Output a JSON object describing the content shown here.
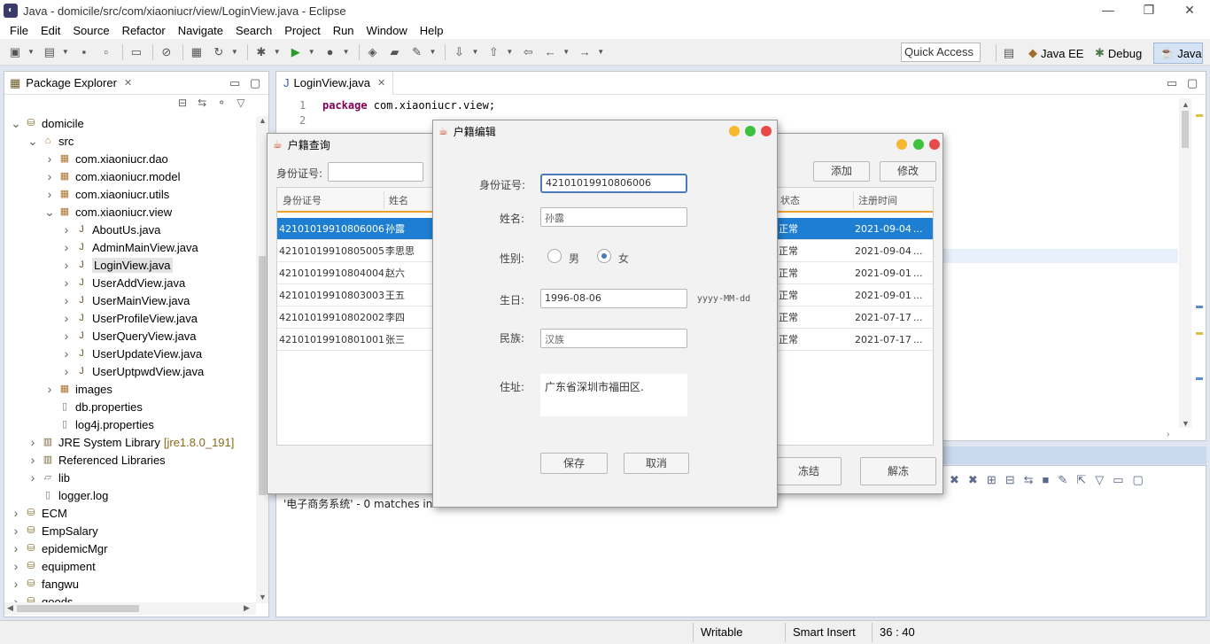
{
  "window": {
    "title": "Java - domicile/src/com/xiaoniucr/view/LoginView.java - Eclipse",
    "app_icon": "eclipse-icon"
  },
  "menu": [
    "File",
    "Edit",
    "Source",
    "Refactor",
    "Navigate",
    "Search",
    "Project",
    "Run",
    "Window",
    "Help"
  ],
  "quick_access": "Quick Access",
  "perspectives": [
    {
      "label": "Java EE",
      "icon": "java-ee-icon"
    },
    {
      "label": "Debug",
      "icon": "debug-icon"
    },
    {
      "label": "Java",
      "icon": "java-icon"
    }
  ],
  "package_explorer": {
    "title": "Package Explorer",
    "tree": [
      {
        "label": "domicile",
        "icon": "project-icon",
        "arrow": "v",
        "indent": 0
      },
      {
        "label": "src",
        "icon": "source-folder-icon",
        "arrow": "v",
        "indent": 1
      },
      {
        "label": "com.xiaoniucr.dao",
        "icon": "package-icon",
        "arrow": ">",
        "indent": 2
      },
      {
        "label": "com.xiaoniucr.model",
        "icon": "package-icon",
        "arrow": ">",
        "indent": 2
      },
      {
        "label": "com.xiaoniucr.utils",
        "icon": "package-icon",
        "arrow": ">",
        "indent": 2
      },
      {
        "label": "com.xiaoniucr.view",
        "icon": "package-icon",
        "arrow": "v",
        "indent": 2
      },
      {
        "label": "AboutUs.java",
        "icon": "java-file-icon",
        "arrow": ">",
        "indent": 3
      },
      {
        "label": "AdminMainView.java",
        "icon": "java-file-icon",
        "arrow": ">",
        "indent": 3
      },
      {
        "label": "LoginView.java",
        "icon": "java-file-icon",
        "arrow": ">",
        "indent": 3,
        "selected": true
      },
      {
        "label": "UserAddView.java",
        "icon": "java-file-icon",
        "arrow": ">",
        "indent": 3
      },
      {
        "label": "UserMainView.java",
        "icon": "java-file-icon",
        "arrow": ">",
        "indent": 3
      },
      {
        "label": "UserProfileView.java",
        "icon": "java-file-icon",
        "arrow": ">",
        "indent": 3
      },
      {
        "label": "UserQueryView.java",
        "icon": "java-file-icon",
        "arrow": ">",
        "indent": 3
      },
      {
        "label": "UserUpdateView.java",
        "icon": "java-file-icon",
        "arrow": ">",
        "indent": 3
      },
      {
        "label": "UserUptpwdView.java",
        "icon": "java-file-icon",
        "arrow": ">",
        "indent": 3
      },
      {
        "label": "images",
        "icon": "package-icon",
        "arrow": ">",
        "indent": 2
      },
      {
        "label": "db.properties",
        "icon": "file-icon",
        "arrow": "",
        "indent": 2
      },
      {
        "label": "log4j.properties",
        "icon": "file-icon",
        "arrow": "",
        "indent": 2
      },
      {
        "label": "JRE System Library",
        "suffix": "[jre1.8.0_191]",
        "icon": "library-icon",
        "arrow": ">",
        "indent": 1
      },
      {
        "label": "Referenced Libraries",
        "icon": "library-icon",
        "arrow": ">",
        "indent": 1
      },
      {
        "label": "lib",
        "icon": "folder-icon",
        "arrow": ">",
        "indent": 1
      },
      {
        "label": "logger.log",
        "icon": "file-icon",
        "arrow": "",
        "indent": 1
      },
      {
        "label": "ECM",
        "icon": "project-icon",
        "arrow": ">",
        "indent": 0
      },
      {
        "label": "EmpSalary",
        "icon": "project-icon",
        "arrow": ">",
        "indent": 0
      },
      {
        "label": "epidemicMgr",
        "icon": "project-icon",
        "arrow": ">",
        "indent": 0
      },
      {
        "label": "equipment",
        "icon": "project-icon",
        "arrow": ">",
        "indent": 0
      },
      {
        "label": "fangwu",
        "icon": "project-icon",
        "arrow": ">",
        "indent": 0
      },
      {
        "label": "goods",
        "icon": "project-icon",
        "arrow": ">",
        "indent": 0
      }
    ]
  },
  "editor": {
    "tab": "LoginView.java",
    "line_numbers": [
      "1",
      "2"
    ],
    "line1_keyword": "package",
    "line1_rest": " com.xiaoniucr.view;"
  },
  "console": {
    "text": "'电子商务系统' - 0 matches in"
  },
  "status": {
    "writable": "Writable",
    "insert": "Smart Insert",
    "position": "36 : 40"
  },
  "query_dialog": {
    "title": "户籍查询",
    "id_label": "身份证号:",
    "add": "添加",
    "edit": "修改",
    "freeze": "冻结",
    "unfreeze": "解冻",
    "headers": {
      "id": "身份证号",
      "name": "姓名",
      "status": "状态",
      "date": "注册时间"
    },
    "rows": [
      {
        "id": "42101019910806006",
        "name": "孙露",
        "status": "正常",
        "date": "2021-09-04",
        "selected": true
      },
      {
        "id": "42101019910805005",
        "name": "李思思",
        "status": "正常",
        "date": "2021-09-04"
      },
      {
        "id": "42101019910804004",
        "name": "赵六",
        "status": "正常",
        "date": "2021-09-01"
      },
      {
        "id": "42101019910803003",
        "name": "王五",
        "status": "正常",
        "date": "2021-09-01"
      },
      {
        "id": "42101019910802002",
        "name": "李四",
        "status": "正常",
        "date": "2021-07-17"
      },
      {
        "id": "42101019910801001",
        "name": "张三",
        "status": "正常",
        "date": "2021-07-17"
      }
    ],
    "ellipsis": "..."
  },
  "edit_dialog": {
    "title": "户籍编辑",
    "id_label": "身份证号:",
    "id_value": "42101019910806006",
    "name_label": "姓名:",
    "name_value": "孙露",
    "gender_label": "性别:",
    "male": "男",
    "female": "女",
    "gender_selected": "女",
    "birth_label": "生日:",
    "birth_value": "1996-08-06",
    "birth_hint": "yyyy-MM-dd",
    "nation_label": "民族:",
    "nation_value": "汉族",
    "address_label": "住址:",
    "address_value": "广东省深圳市福田区.",
    "save": "保存",
    "cancel": "取消"
  }
}
